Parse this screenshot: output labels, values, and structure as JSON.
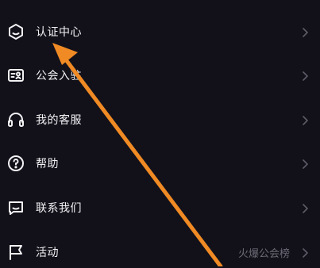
{
  "menu": {
    "items": [
      {
        "label": "认证中心",
        "icon": "certification-shield-icon"
      },
      {
        "label": "公会入驻",
        "icon": "guild-id-card-icon"
      },
      {
        "label": "我的客服",
        "icon": "headset-icon"
      },
      {
        "label": "帮助",
        "icon": "help-question-icon"
      },
      {
        "label": "联系我们",
        "icon": "contact-message-icon"
      },
      {
        "label": "活动",
        "icon": "flag-icon",
        "extra": "火爆公会榜"
      }
    ]
  },
  "colors": {
    "background": "#12111a",
    "text": "#f2f2f4",
    "muted": "#6c6b75",
    "annotation_arrow": "#f08a24"
  }
}
